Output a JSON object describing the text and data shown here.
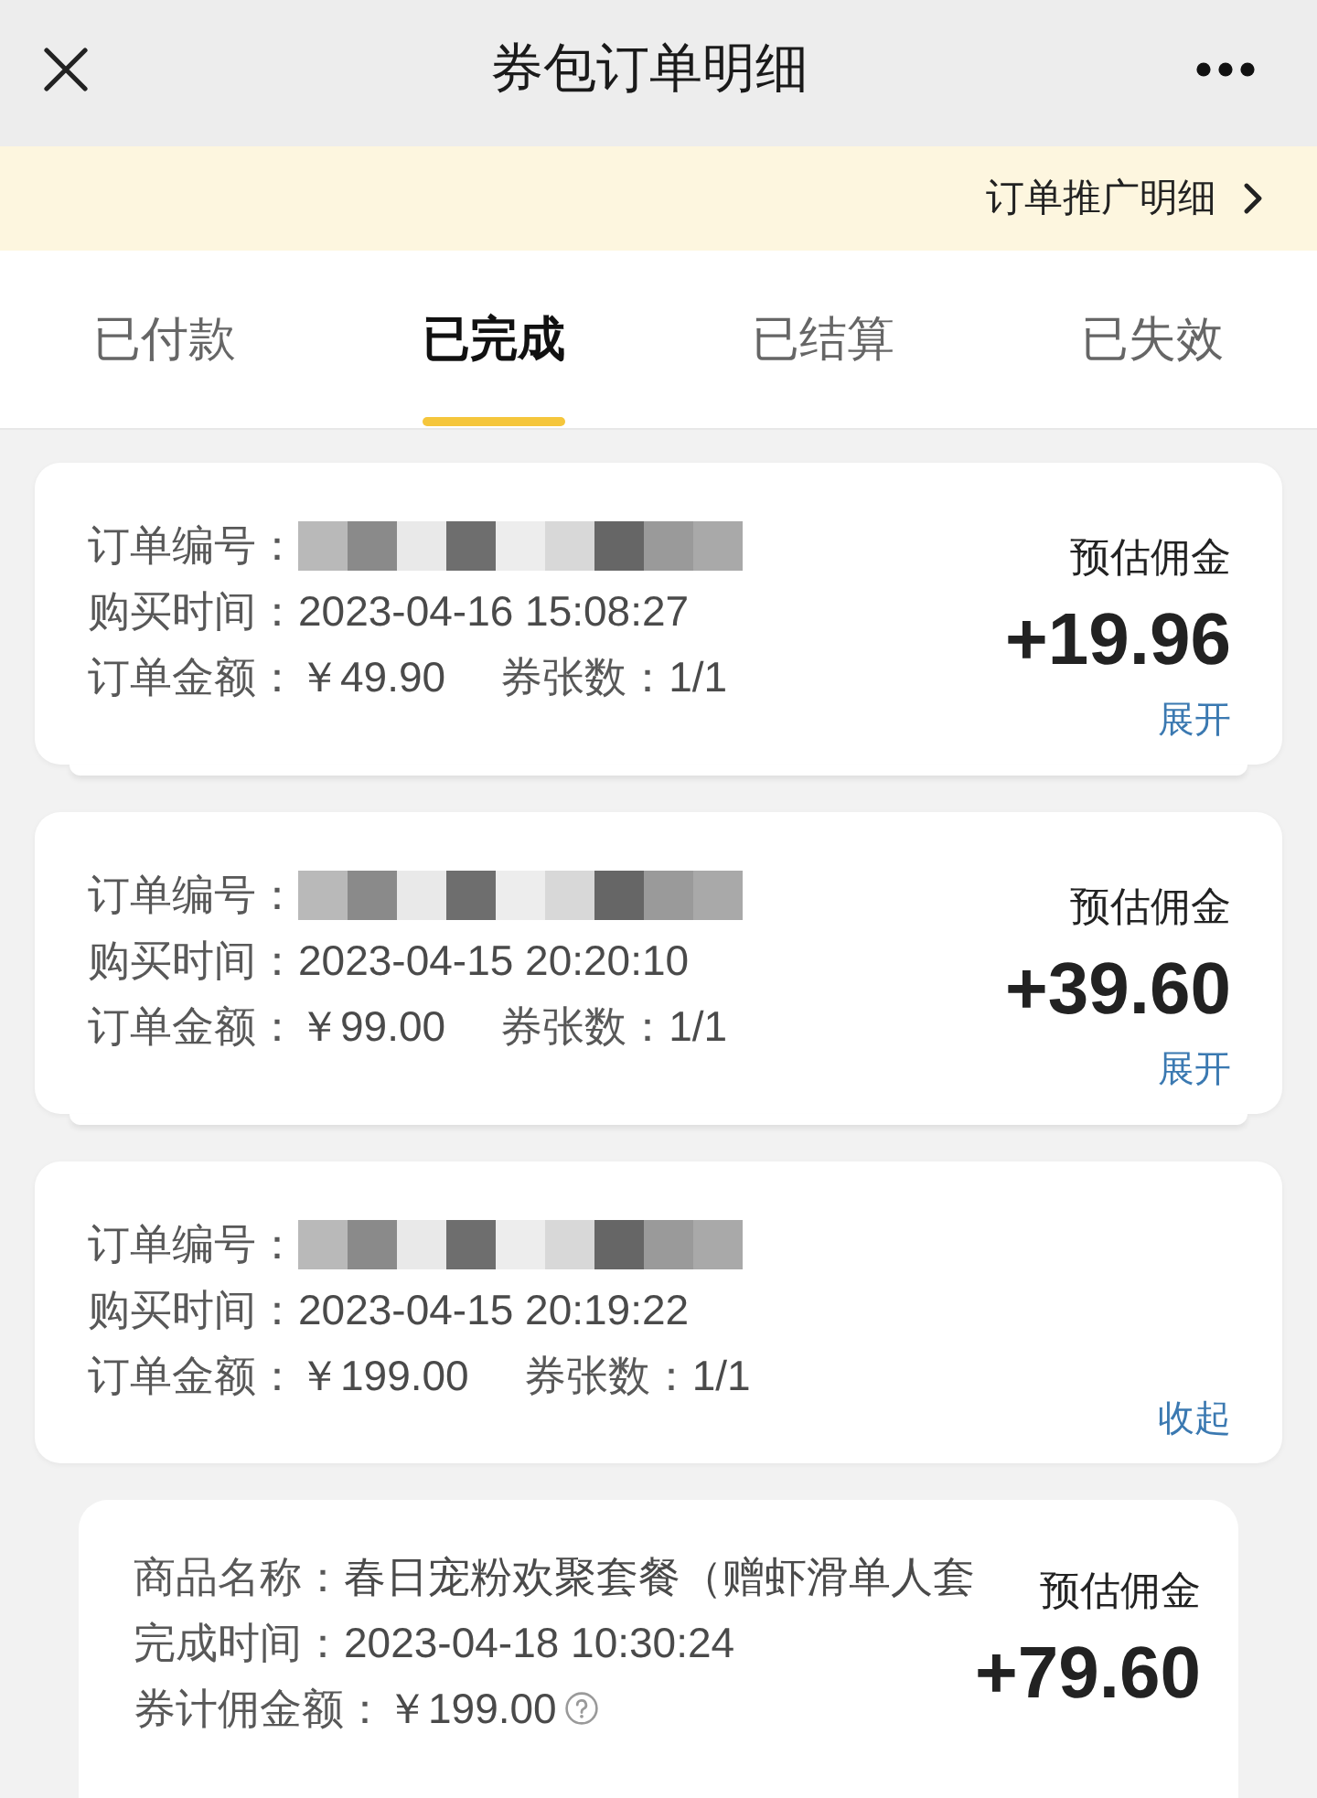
{
  "nav": {
    "title": "券包订单明细"
  },
  "banner": {
    "link": "订单推广明细"
  },
  "tabs": [
    {
      "label": "已付款",
      "selected": false
    },
    {
      "label": "已完成",
      "selected": true
    },
    {
      "label": "已结算",
      "selected": false
    },
    {
      "label": "已失效",
      "selected": false
    }
  ],
  "orders": [
    {
      "order_no": {
        "label": "订单编号："
      },
      "purchase_time": {
        "label": "购买时间：",
        "value": "2023-04-16 15:08:27"
      },
      "amount": {
        "label": "订单金额：",
        "value": "￥49.90"
      },
      "coupon_count": {
        "label": "券张数：",
        "value": "1/1"
      },
      "commission_label": "预估佣金",
      "commission": "+19.96",
      "toggle": "展开",
      "expanded": false
    },
    {
      "order_no": {
        "label": "订单编号："
      },
      "purchase_time": {
        "label": "购买时间：",
        "value": "2023-04-15 20:20:10"
      },
      "amount": {
        "label": "订单金额：",
        "value": "￥99.00"
      },
      "coupon_count": {
        "label": "券张数：",
        "value": "1/1"
      },
      "commission_label": "预估佣金",
      "commission": "+39.60",
      "toggle": "展开",
      "expanded": false
    },
    {
      "order_no": {
        "label": "订单编号："
      },
      "purchase_time": {
        "label": "购买时间：",
        "value": "2023-04-15 20:19:22"
      },
      "amount": {
        "label": "订单金额：",
        "value": "￥199.00"
      },
      "coupon_count": {
        "label": "券张数：",
        "value": "1/1"
      },
      "toggle": "收起",
      "expanded": true,
      "items": [
        {
          "name": {
            "label": "商品名称：",
            "value": "春日宠粉欢聚套餐（赠虾滑单人套"
          },
          "completed_time": {
            "label": "完成时间：",
            "value": "2023-04-18 10:30:24"
          },
          "coupon_commission_amount": {
            "label": "券计佣金额：",
            "value": "￥199.00",
            "help": true
          },
          "commission_label": "预估佣金",
          "commission": "+79.60"
        }
      ]
    }
  ]
}
